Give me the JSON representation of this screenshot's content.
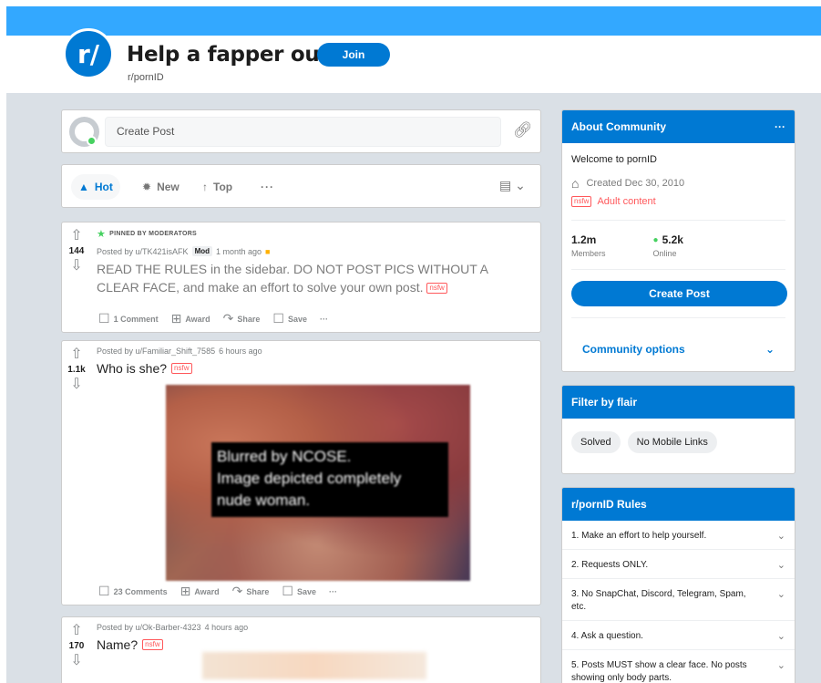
{
  "header": {
    "icon_text": "r/",
    "title": "Help a fapper out",
    "join_label": "Join",
    "subreddit": "r/pornID"
  },
  "create_post": {
    "placeholder": "Create Post"
  },
  "sort": {
    "hot": "Hot",
    "new": "New",
    "top": "Top",
    "more": "···"
  },
  "posts": [
    {
      "pinned_label": "PINNED BY MODERATORS",
      "score": "144",
      "author": "Posted by u/TK421isAFK",
      "badge": "Mod",
      "time": "1 month ago",
      "text": "READ THE RULES in the sidebar. DO NOT POST PICS WITHOUT A CLEAR FACE, and make an effort to solve your own post.",
      "nsfw": "nsfw",
      "comments": "1 Comment",
      "award": "Award",
      "share": "Share",
      "save": "Save"
    },
    {
      "score": "1.1k",
      "author": "Posted by u/Familiar_Shift_7585",
      "time": "6 hours ago",
      "title": "Who is she?",
      "nsfw": "nsfw",
      "image_caption_1": "Blurred by NCOSE.",
      "image_caption_2": "Image depicted completely",
      "image_caption_3": "nude woman.",
      "comments": "23 Comments",
      "award": "Award",
      "share": "Share",
      "save": "Save"
    },
    {
      "score": "170",
      "author": "Posted by u/Ok-Barber-4323",
      "time": "4 hours ago",
      "title": "Name?",
      "nsfw": "nsfw"
    }
  ],
  "sidebar": {
    "about": {
      "heading": "About Community",
      "more": "···",
      "welcome": "Welcome to pornID",
      "created": "Created Dec 30, 2010",
      "nsfw": "nsfw",
      "adult_label": "Adult content",
      "members_count": "1.2m",
      "members_label": "Members",
      "online_count": "5.2k",
      "online_label": "Online",
      "create_post": "Create Post",
      "options": "Community options"
    },
    "flair": {
      "heading": "Filter by flair",
      "pills": [
        "Solved",
        "No Mobile Links"
      ]
    },
    "rules": {
      "heading": "r/pornID Rules",
      "items": [
        "1. Make an effort to help yourself.",
        "2. Requests ONLY.",
        "3. No SnapChat, Discord, Telegram, Spam, etc.",
        "4. Ask a question.",
        "5. Posts MUST show a clear face. No posts showing only body parts."
      ]
    }
  },
  "colors": {
    "banner": "#33a8ff",
    "accent": "#0079d3",
    "nsfw": "#ff585b",
    "online": "#46d160"
  }
}
